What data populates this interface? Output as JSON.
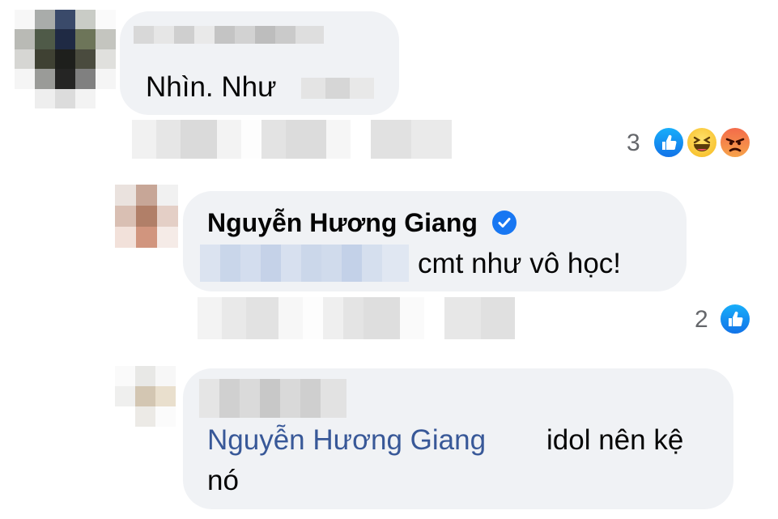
{
  "comments": [
    {
      "text_visible": "Nhìn. Như",
      "reactions": {
        "count": "3",
        "icons": [
          "like-icon",
          "haha-icon",
          "angry-icon"
        ]
      }
    },
    {
      "author": "Nguyễn Hương Giang",
      "verified": true,
      "text_visible": "cmt như vô học!",
      "reactions": {
        "count": "2",
        "icons": [
          "like-icon"
        ]
      }
    },
    {
      "mention": "Nguyễn Hương Giang",
      "text_line1": "idol nên kệ",
      "text_line2": "nó"
    }
  ],
  "colors": {
    "bubble": "#f0f2f5",
    "mention_link": "#385898",
    "like_blue": "#1877f2",
    "meta_gray": "#65676b"
  }
}
